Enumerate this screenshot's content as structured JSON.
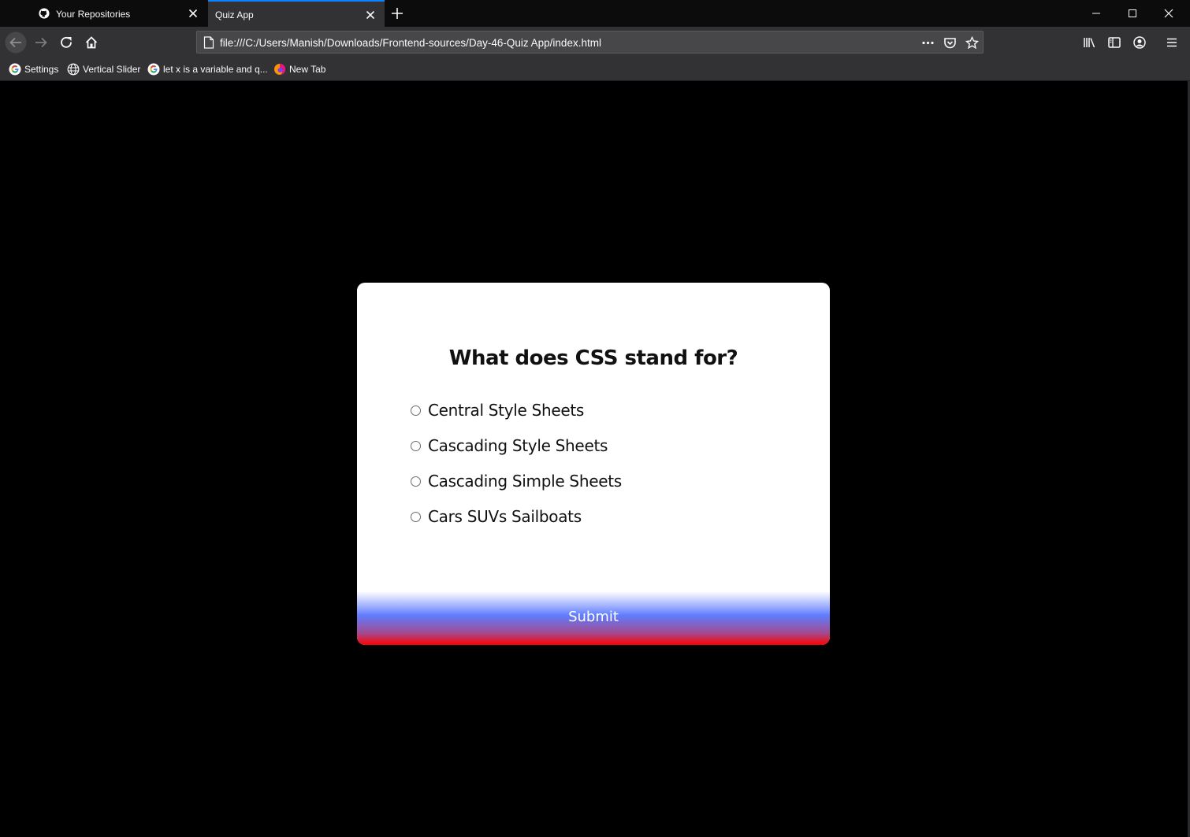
{
  "browser": {
    "tabs": [
      {
        "label": "Your Repositories",
        "icon": "github-icon",
        "active": false
      },
      {
        "label": "Quiz App",
        "icon": "none",
        "active": true
      }
    ],
    "url": "file:///C:/Users/Manish/Downloads/Frontend-sources/Day-46-Quiz App/index.html",
    "bookmarks": [
      {
        "label": "Settings",
        "icon": "google-icon"
      },
      {
        "label": "Vertical Slider",
        "icon": "globe-icon"
      },
      {
        "label": "let x is a variable and q...",
        "icon": "google-icon"
      },
      {
        "label": "New Tab",
        "icon": "firefox-icon"
      }
    ],
    "colors": {
      "tab_accent": "#0a84ff",
      "toolbar": "#323234",
      "tabstrip": "#0c0c0d"
    }
  },
  "quiz": {
    "question": "What does CSS stand for?",
    "answers": [
      {
        "label": "Central Style Sheets",
        "selected": false
      },
      {
        "label": "Cascading Style Sheets",
        "selected": false
      },
      {
        "label": "Cascading Simple Sheets",
        "selected": false
      },
      {
        "label": "Cars SUVs Sailboats",
        "selected": false
      }
    ],
    "submit_label": "Submit",
    "colors": {
      "background": "#000000",
      "card": "#ffffff",
      "submit_gradient": [
        "#ffffff",
        "#5f7cff",
        "#ff0000"
      ]
    }
  }
}
